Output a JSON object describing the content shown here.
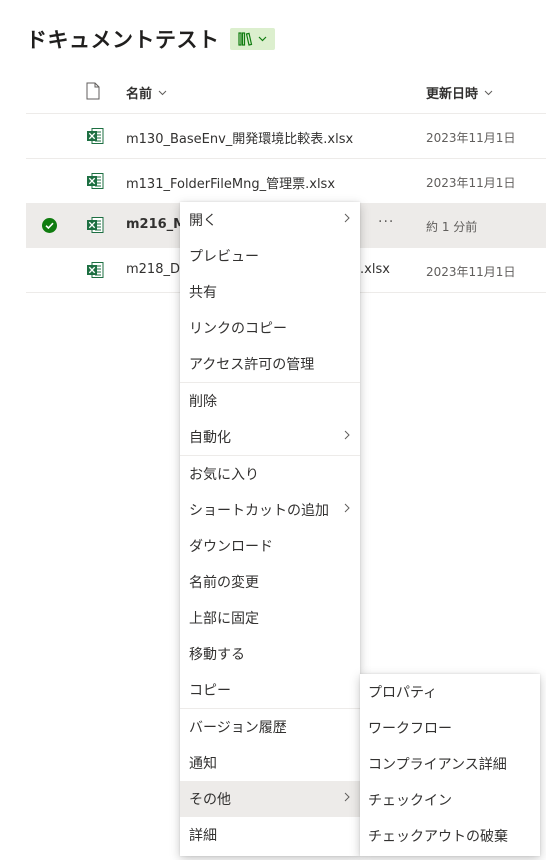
{
  "library": {
    "title": "ドキュメントテスト"
  },
  "columns": {
    "name": "名前",
    "modified": "更新日時"
  },
  "rows": [
    {
      "name": "m130_BaseEnv_開発環境比較表.xlsx",
      "modified": "2023年11月1日"
    },
    {
      "name": "m131_FolderFileMng_管理票.xlsx",
      "modified": "2023年11月1日"
    },
    {
      "name": "m216_M",
      "modified": "約 1 分前",
      "more": "···"
    },
    {
      "name_start": "m218_Dy",
      "name_end": ".xlsx",
      "modified": "2023年11月1日"
    }
  ],
  "context_menu": {
    "items": [
      {
        "label": "開く"
      },
      {
        "label": "プレビュー"
      },
      {
        "label": "共有"
      },
      {
        "label": "リンクのコピー"
      },
      {
        "label": "アクセス許可の管理"
      },
      {
        "label": "削除"
      },
      {
        "label": "自動化"
      },
      {
        "label": "お気に入り"
      },
      {
        "label": "ショートカットの追加"
      },
      {
        "label": "ダウンロード"
      },
      {
        "label": "名前の変更"
      },
      {
        "label": "上部に固定"
      },
      {
        "label": "移動する"
      },
      {
        "label": "コピー"
      },
      {
        "label": "バージョン履歴"
      },
      {
        "label": "通知"
      },
      {
        "label": "その他"
      },
      {
        "label": "詳細"
      }
    ]
  },
  "submenu": {
    "items": [
      {
        "label": "プロパティ"
      },
      {
        "label": "ワークフロー"
      },
      {
        "label": "コンプライアンス詳細"
      },
      {
        "label": "チェックイン"
      },
      {
        "label": "チェックアウトの破棄"
      }
    ]
  },
  "colors": {
    "accent_green": "#107c10",
    "excel_green": "#1d6f42",
    "selected_bg": "#edebe9",
    "view_badge_bg": "#dcefce"
  }
}
